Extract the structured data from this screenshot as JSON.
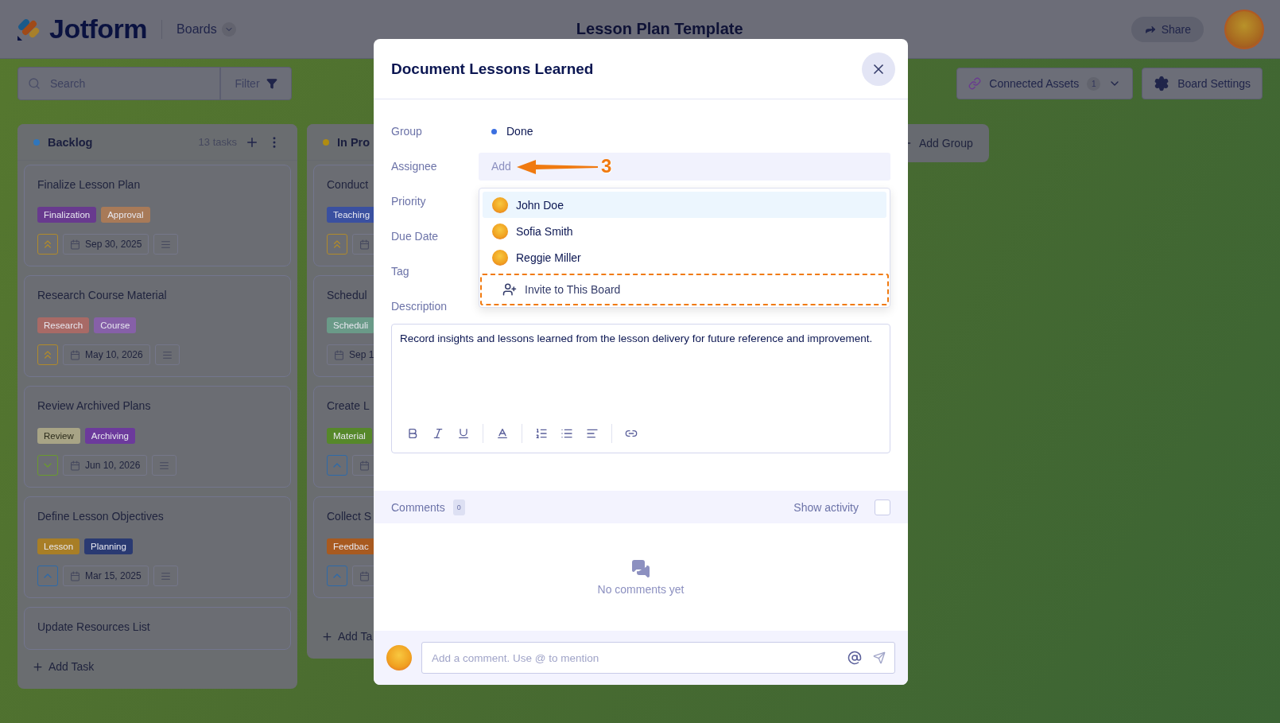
{
  "header": {
    "logo": "Jotform",
    "menu": "Boards",
    "title": "Lesson Plan Template",
    "share": "Share"
  },
  "toolbar": {
    "search_placeholder": "Search",
    "filter": "Filter",
    "connected_assets": {
      "label": "Connected Assets",
      "count": "1"
    },
    "board_settings": "Board Settings"
  },
  "columns": [
    {
      "name": "Backlog",
      "color": "#2f76bc",
      "count": "13 tasks",
      "actions_visible": true,
      "add_task": "Add Task",
      "cards": [
        {
          "title": "Finalize Lesson Plan",
          "tags": [
            {
              "label": "Finalization",
              "color": "#683a8e"
            },
            {
              "label": "Approval",
              "color": "#a87a58"
            }
          ],
          "priority": {
            "kind": "highest"
          },
          "date_pill": true,
          "date": "Sep 30, 2025",
          "notes_icon": true
        },
        {
          "title": "Research Course Material",
          "tags": [
            {
              "label": "Research",
              "color": "#a86a66"
            },
            {
              "label": "Course",
              "color": "#8660a8"
            }
          ],
          "priority": {
            "kind": "highest"
          },
          "date_pill": true,
          "date": "May 10, 2026",
          "notes_icon": true
        },
        {
          "title": "Review Archived Plans",
          "tags": [
            {
              "label": "Review",
              "color": "#a8a486"
            },
            {
              "label": "Archiving",
              "color": "#6c3a9c"
            }
          ],
          "priority": {
            "kind": "low"
          },
          "date_pill": true,
          "date": "Jun 10, 2026",
          "notes_icon": true
        },
        {
          "title": "Define Lesson Objectives",
          "tags": [
            {
              "label": "Lesson",
              "color": "#a87e26"
            },
            {
              "label": "Planning",
              "color": "#2a3a72"
            }
          ],
          "priority": {
            "kind": "medium"
          },
          "date_pill": true,
          "date": "Mar 15, 2025",
          "notes_icon": true
        },
        {
          "title": "Update Resources List"
        }
      ]
    },
    {
      "name": "In Pro",
      "color": "#b08c10",
      "actions_visible": false,
      "add_task": "Add Ta",
      "cards": [
        {
          "title": "Conduct",
          "tags": [
            {
              "label": "Teaching",
              "color": "#3a50a0"
            }
          ],
          "priority": {
            "kind": "highest"
          },
          "date_pill": true
        },
        {
          "title": "Schedul",
          "tags": [
            {
              "label": "Scheduli",
              "color": "#6a9a88"
            }
          ],
          "date_pill": true,
          "date": "Sep 1"
        },
        {
          "title": "Create L",
          "tags": [
            {
              "label": "Material",
              "color": "#56882a"
            }
          ],
          "priority": {
            "kind": "medium"
          },
          "date_pill": true
        },
        {
          "title": "Collect S",
          "tags": [
            {
              "label": "Feedbac",
              "color": "#a85a20"
            }
          ],
          "priority": {
            "kind": "medium"
          },
          "date_pill": true
        }
      ]
    }
  ],
  "add_group": "Add Group",
  "modal": {
    "title": "Document Lessons Learned",
    "fields": [
      {
        "label": "Group",
        "kind": "group",
        "value": "Done",
        "color": "#3b6fe0"
      },
      {
        "label": "Assignee",
        "kind": "assignee",
        "placeholder": "Add"
      },
      {
        "label": "Priority",
        "kind": "empty"
      },
      {
        "label": "Due Date",
        "kind": "empty"
      },
      {
        "label": "Tag",
        "kind": "empty"
      },
      {
        "label": "Description",
        "kind": "empty"
      }
    ],
    "assignee_menu": {
      "users": [
        {
          "name": "John Doe",
          "selected": true
        },
        {
          "name": "Sofia Smith",
          "selected": false
        },
        {
          "name": "Reggie Miller",
          "selected": false
        }
      ],
      "invite": {
        "label": "Invite to This Board",
        "outlined": true
      }
    },
    "annotation": {
      "label": "3"
    },
    "description": "Record insights and lessons learned from the lesson delivery for future reference and improvement.",
    "comments": {
      "label": "Comments",
      "count": "0",
      "show_activity": {
        "label": "Show activity",
        "checked": false
      },
      "empty": "No comments yet",
      "placeholder": "Add a comment. Use @ to mention"
    }
  }
}
